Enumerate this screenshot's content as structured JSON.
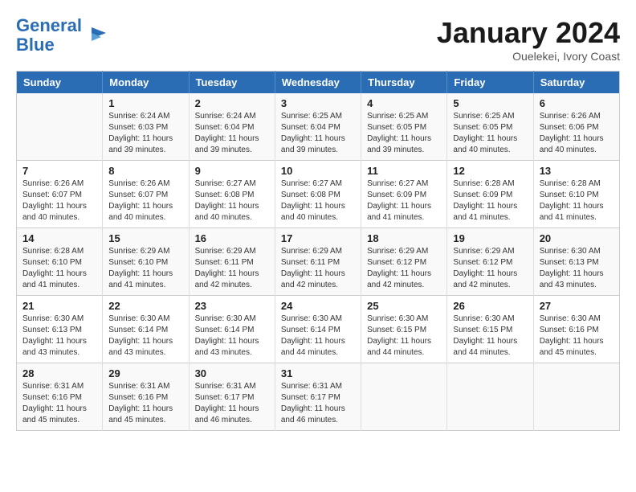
{
  "header": {
    "logo_line1": "General",
    "logo_line2": "Blue",
    "month": "January 2024",
    "location": "Ouelekei, Ivory Coast"
  },
  "weekdays": [
    "Sunday",
    "Monday",
    "Tuesday",
    "Wednesday",
    "Thursday",
    "Friday",
    "Saturday"
  ],
  "weeks": [
    [
      {
        "num": "",
        "info": ""
      },
      {
        "num": "1",
        "info": "Sunrise: 6:24 AM\nSunset: 6:03 PM\nDaylight: 11 hours\nand 39 minutes."
      },
      {
        "num": "2",
        "info": "Sunrise: 6:24 AM\nSunset: 6:04 PM\nDaylight: 11 hours\nand 39 minutes."
      },
      {
        "num": "3",
        "info": "Sunrise: 6:25 AM\nSunset: 6:04 PM\nDaylight: 11 hours\nand 39 minutes."
      },
      {
        "num": "4",
        "info": "Sunrise: 6:25 AM\nSunset: 6:05 PM\nDaylight: 11 hours\nand 39 minutes."
      },
      {
        "num": "5",
        "info": "Sunrise: 6:25 AM\nSunset: 6:05 PM\nDaylight: 11 hours\nand 40 minutes."
      },
      {
        "num": "6",
        "info": "Sunrise: 6:26 AM\nSunset: 6:06 PM\nDaylight: 11 hours\nand 40 minutes."
      }
    ],
    [
      {
        "num": "7",
        "info": "Sunrise: 6:26 AM\nSunset: 6:07 PM\nDaylight: 11 hours\nand 40 minutes."
      },
      {
        "num": "8",
        "info": "Sunrise: 6:26 AM\nSunset: 6:07 PM\nDaylight: 11 hours\nand 40 minutes."
      },
      {
        "num": "9",
        "info": "Sunrise: 6:27 AM\nSunset: 6:08 PM\nDaylight: 11 hours\nand 40 minutes."
      },
      {
        "num": "10",
        "info": "Sunrise: 6:27 AM\nSunset: 6:08 PM\nDaylight: 11 hours\nand 40 minutes."
      },
      {
        "num": "11",
        "info": "Sunrise: 6:27 AM\nSunset: 6:09 PM\nDaylight: 11 hours\nand 41 minutes."
      },
      {
        "num": "12",
        "info": "Sunrise: 6:28 AM\nSunset: 6:09 PM\nDaylight: 11 hours\nand 41 minutes."
      },
      {
        "num": "13",
        "info": "Sunrise: 6:28 AM\nSunset: 6:10 PM\nDaylight: 11 hours\nand 41 minutes."
      }
    ],
    [
      {
        "num": "14",
        "info": "Sunrise: 6:28 AM\nSunset: 6:10 PM\nDaylight: 11 hours\nand 41 minutes."
      },
      {
        "num": "15",
        "info": "Sunrise: 6:29 AM\nSunset: 6:10 PM\nDaylight: 11 hours\nand 41 minutes."
      },
      {
        "num": "16",
        "info": "Sunrise: 6:29 AM\nSunset: 6:11 PM\nDaylight: 11 hours\nand 42 minutes."
      },
      {
        "num": "17",
        "info": "Sunrise: 6:29 AM\nSunset: 6:11 PM\nDaylight: 11 hours\nand 42 minutes."
      },
      {
        "num": "18",
        "info": "Sunrise: 6:29 AM\nSunset: 6:12 PM\nDaylight: 11 hours\nand 42 minutes."
      },
      {
        "num": "19",
        "info": "Sunrise: 6:29 AM\nSunset: 6:12 PM\nDaylight: 11 hours\nand 42 minutes."
      },
      {
        "num": "20",
        "info": "Sunrise: 6:30 AM\nSunset: 6:13 PM\nDaylight: 11 hours\nand 43 minutes."
      }
    ],
    [
      {
        "num": "21",
        "info": "Sunrise: 6:30 AM\nSunset: 6:13 PM\nDaylight: 11 hours\nand 43 minutes."
      },
      {
        "num": "22",
        "info": "Sunrise: 6:30 AM\nSunset: 6:14 PM\nDaylight: 11 hours\nand 43 minutes."
      },
      {
        "num": "23",
        "info": "Sunrise: 6:30 AM\nSunset: 6:14 PM\nDaylight: 11 hours\nand 43 minutes."
      },
      {
        "num": "24",
        "info": "Sunrise: 6:30 AM\nSunset: 6:14 PM\nDaylight: 11 hours\nand 44 minutes."
      },
      {
        "num": "25",
        "info": "Sunrise: 6:30 AM\nSunset: 6:15 PM\nDaylight: 11 hours\nand 44 minutes."
      },
      {
        "num": "26",
        "info": "Sunrise: 6:30 AM\nSunset: 6:15 PM\nDaylight: 11 hours\nand 44 minutes."
      },
      {
        "num": "27",
        "info": "Sunrise: 6:30 AM\nSunset: 6:16 PM\nDaylight: 11 hours\nand 45 minutes."
      }
    ],
    [
      {
        "num": "28",
        "info": "Sunrise: 6:31 AM\nSunset: 6:16 PM\nDaylight: 11 hours\nand 45 minutes."
      },
      {
        "num": "29",
        "info": "Sunrise: 6:31 AM\nSunset: 6:16 PM\nDaylight: 11 hours\nand 45 minutes."
      },
      {
        "num": "30",
        "info": "Sunrise: 6:31 AM\nSunset: 6:17 PM\nDaylight: 11 hours\nand 46 minutes."
      },
      {
        "num": "31",
        "info": "Sunrise: 6:31 AM\nSunset: 6:17 PM\nDaylight: 11 hours\nand 46 minutes."
      },
      {
        "num": "",
        "info": ""
      },
      {
        "num": "",
        "info": ""
      },
      {
        "num": "",
        "info": ""
      }
    ]
  ]
}
